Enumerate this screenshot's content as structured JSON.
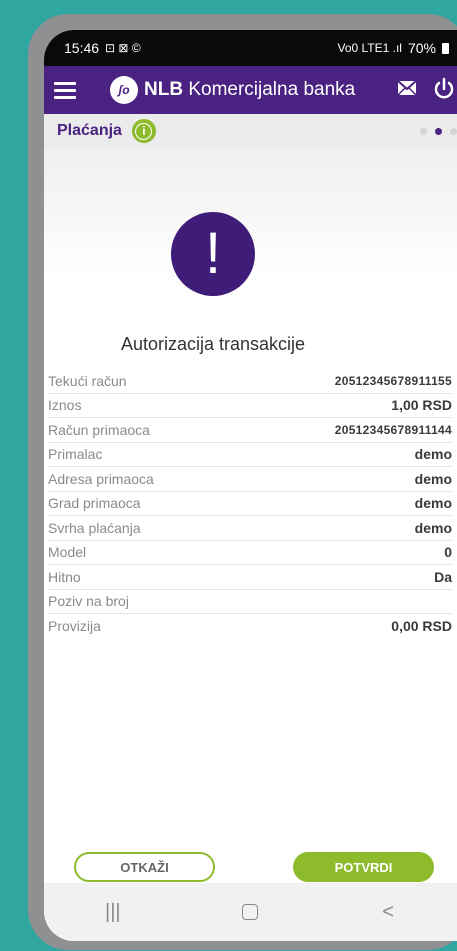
{
  "status_bar": {
    "time": "15:46",
    "left_icons": "⊡ ⊠ ©",
    "signal": "Vo0 LTE1 .ıl",
    "battery": "70%"
  },
  "app_bar": {
    "brand_bold": "NLB",
    "brand_rest": " Komercijalna banka",
    "logo_text": "ʃo"
  },
  "subheader": {
    "title": "Plaćanja",
    "info_label": "i"
  },
  "alert": {
    "symbol": "!"
  },
  "transaction": {
    "title": "Autorizacija transakcije",
    "rows": [
      {
        "label": "Tekući račun",
        "value": "20512345678911155"
      },
      {
        "label": "Iznos",
        "value": "1,00 RSD"
      },
      {
        "label": "Račun primaoca",
        "value": "20512345678911144"
      },
      {
        "label": "Primalac",
        "value": "demo"
      },
      {
        "label": "Adresa primaoca",
        "value": "demo"
      },
      {
        "label": "Grad primaoca",
        "value": "demo"
      },
      {
        "label": "Svrha plaćanja",
        "value": "demo"
      },
      {
        "label": "Model",
        "value": "0"
      },
      {
        "label": "Hitno",
        "value": "Da"
      },
      {
        "label": "Poziv na broj",
        "value": ""
      },
      {
        "label": "Provizija",
        "value": "0,00 RSD"
      }
    ]
  },
  "buttons": {
    "cancel": "OTKAŽI",
    "confirm": "POTVRDI"
  },
  "nav": {
    "recents": "|||",
    "back": "<"
  },
  "colors": {
    "brand_purple": "#4a2382",
    "accent_green": "#8dbb2b"
  }
}
